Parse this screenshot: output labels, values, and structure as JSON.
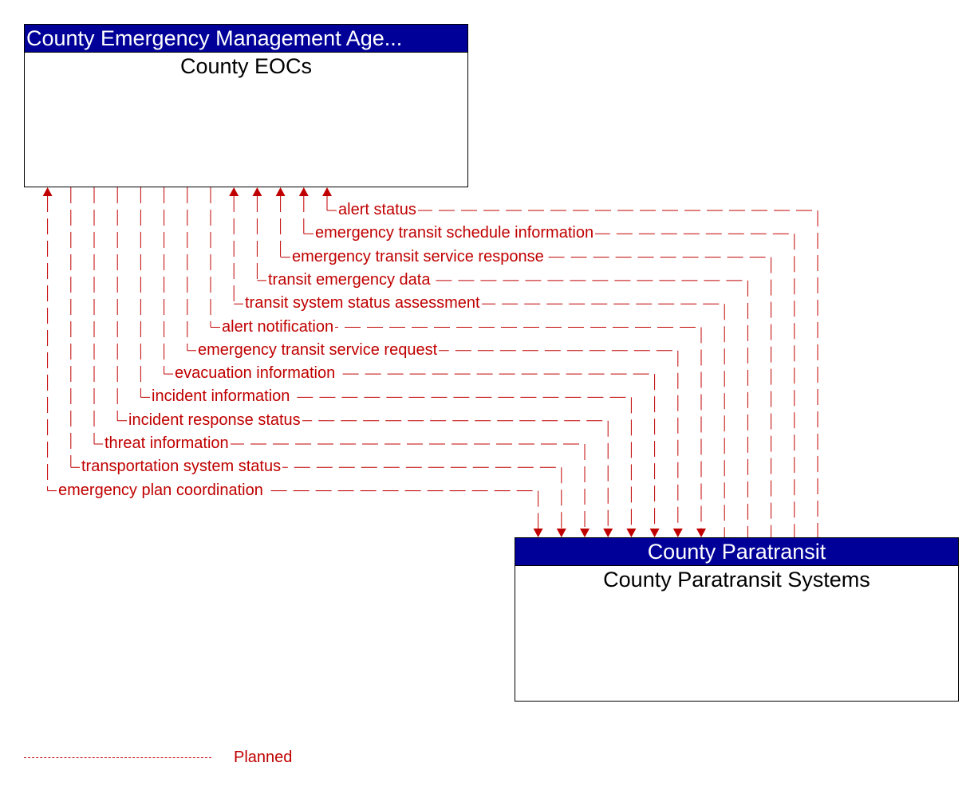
{
  "diagram": {
    "elements": [
      {
        "id": "eoc",
        "owner": "County Emergency Management Age...",
        "name": "County EOCs"
      },
      {
        "id": "para",
        "owner": "County Paratransit",
        "name": "County Paratransit Systems"
      }
    ],
    "flows": [
      {
        "label": "alert status",
        "from": "para",
        "to": "eoc",
        "status": "Planned"
      },
      {
        "label": "emergency transit schedule information",
        "from": "para",
        "to": "eoc",
        "status": "Planned"
      },
      {
        "label": "emergency transit service response",
        "from": "para",
        "to": "eoc",
        "status": "Planned"
      },
      {
        "label": "transit emergency data",
        "from": "para",
        "to": "eoc",
        "status": "Planned"
      },
      {
        "label": "transit system status assessment",
        "from": "para",
        "to": "eoc",
        "status": "Planned"
      },
      {
        "label": "alert notification",
        "from": "eoc",
        "to": "para",
        "status": "Planned"
      },
      {
        "label": "emergency transit service request",
        "from": "eoc",
        "to": "para",
        "status": "Planned"
      },
      {
        "label": "evacuation information",
        "from": "eoc",
        "to": "para",
        "status": "Planned"
      },
      {
        "label": "incident information",
        "from": "eoc",
        "to": "para",
        "status": "Planned"
      },
      {
        "label": "incident response status",
        "from": "eoc",
        "to": "para",
        "status": "Planned"
      },
      {
        "label": "threat information",
        "from": "eoc",
        "to": "para",
        "status": "Planned"
      },
      {
        "label": "transportation system status",
        "from": "eoc",
        "to": "para",
        "status": "Planned"
      },
      {
        "label": "emergency plan coordination",
        "from": "both",
        "to": "both",
        "status": "Planned"
      }
    ],
    "legend": [
      {
        "label": "Planned",
        "style": "dashed",
        "color": "#c00000"
      }
    ],
    "colors": {
      "header_bg": "#000099",
      "flow": "#c00000"
    }
  }
}
